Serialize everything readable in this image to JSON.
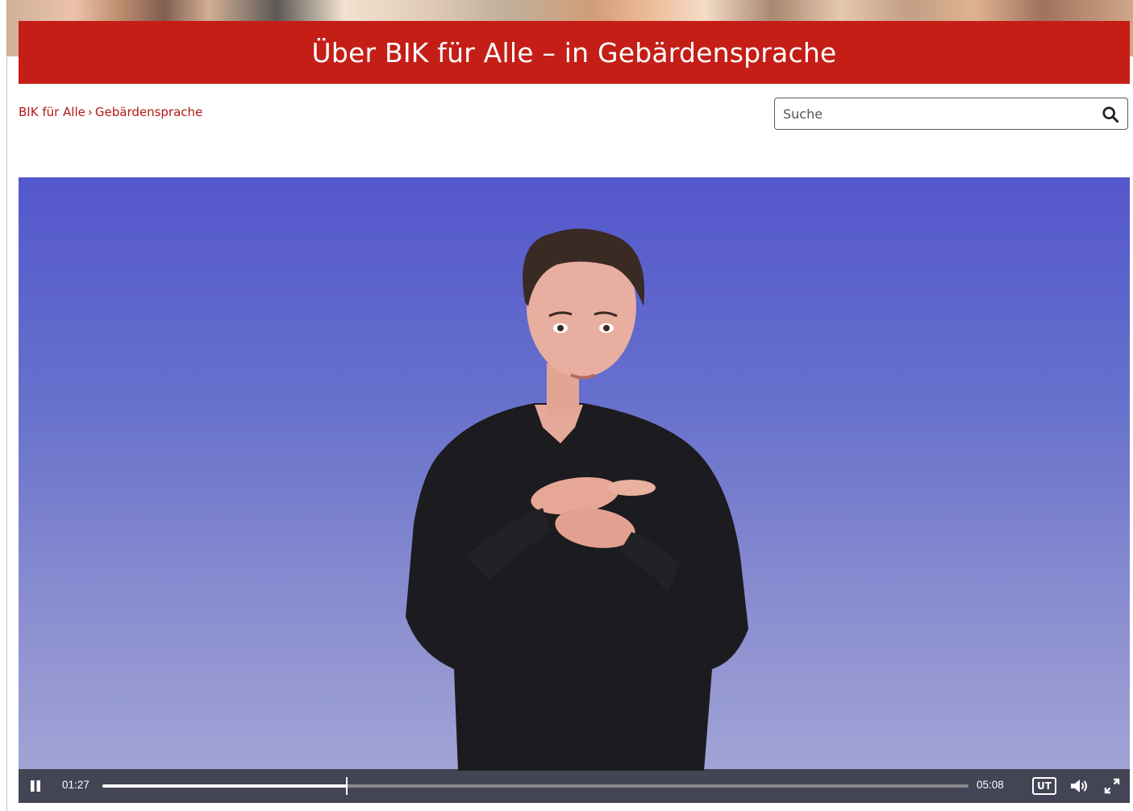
{
  "header": {
    "title": "Über BIK für Alle – in Gebärdensprache"
  },
  "breadcrumb": {
    "items": [
      "BIK für Alle",
      "Gebärdensprache"
    ],
    "separator": "›"
  },
  "search": {
    "placeholder": "Suche",
    "value": "",
    "icon": "search-icon"
  },
  "video": {
    "current_time": "01:27",
    "total_time": "05:08",
    "progress_fraction": 0.2825,
    "subtitles_label": "UT",
    "state": "playing",
    "controls": {
      "pause_icon": "pause-icon",
      "subtitles_icon": "subtitles-icon",
      "volume_icon": "volume-icon",
      "fullscreen_icon": "fullscreen-icon"
    }
  },
  "colors": {
    "brand_red": "#c41e17",
    "breadcrumb_red": "#b21a14",
    "video_bg_top": "#5457cd",
    "video_bg_bottom": "#a4a8d6"
  }
}
